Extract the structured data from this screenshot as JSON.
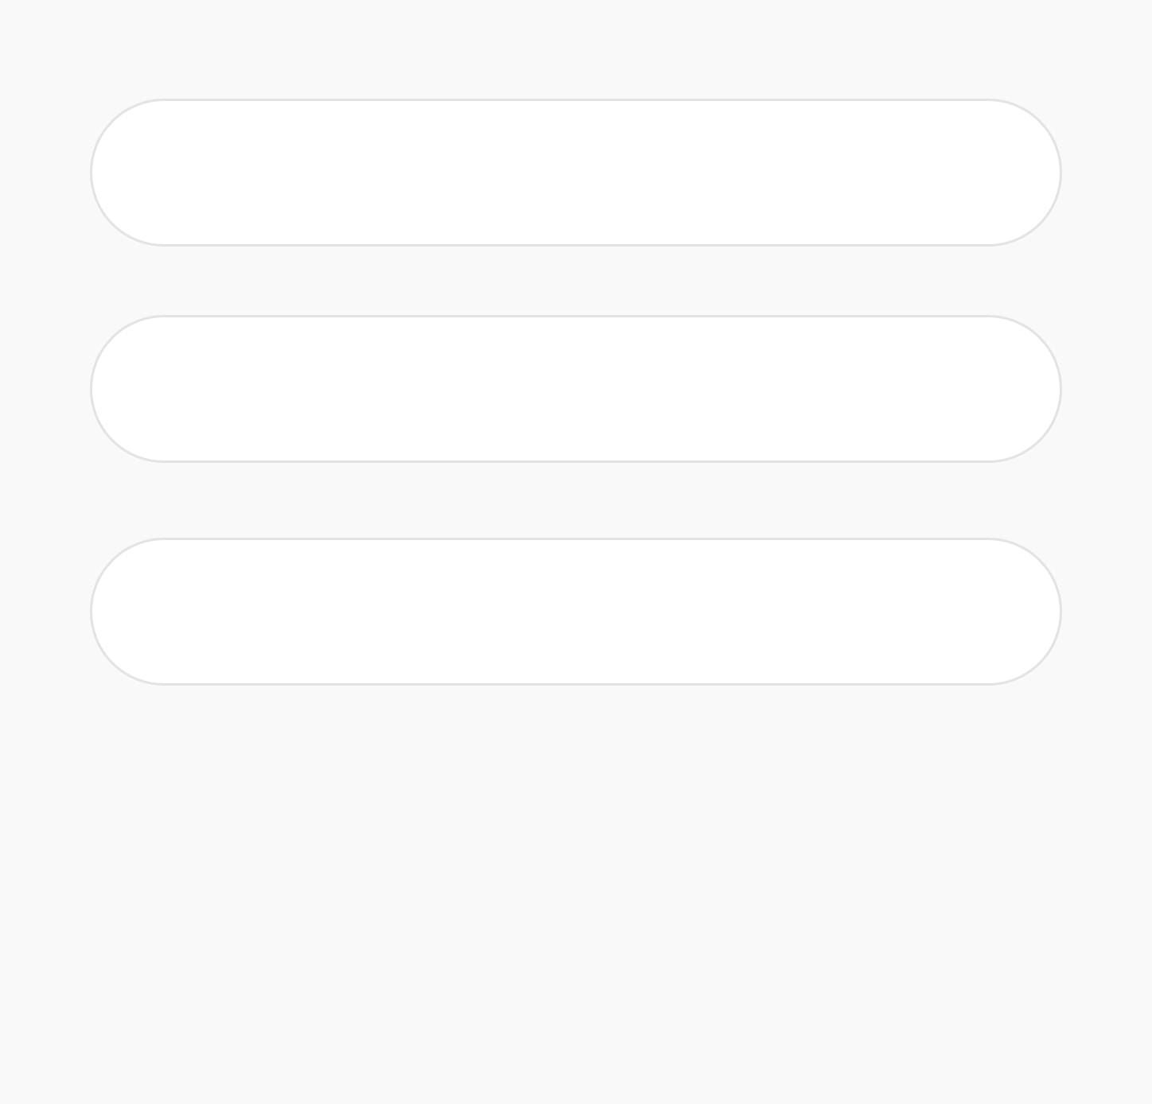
{
  "fields": [
    {
      "value": "",
      "placeholder": ""
    },
    {
      "value": "",
      "placeholder": ""
    },
    {
      "value": "",
      "placeholder": ""
    }
  ]
}
